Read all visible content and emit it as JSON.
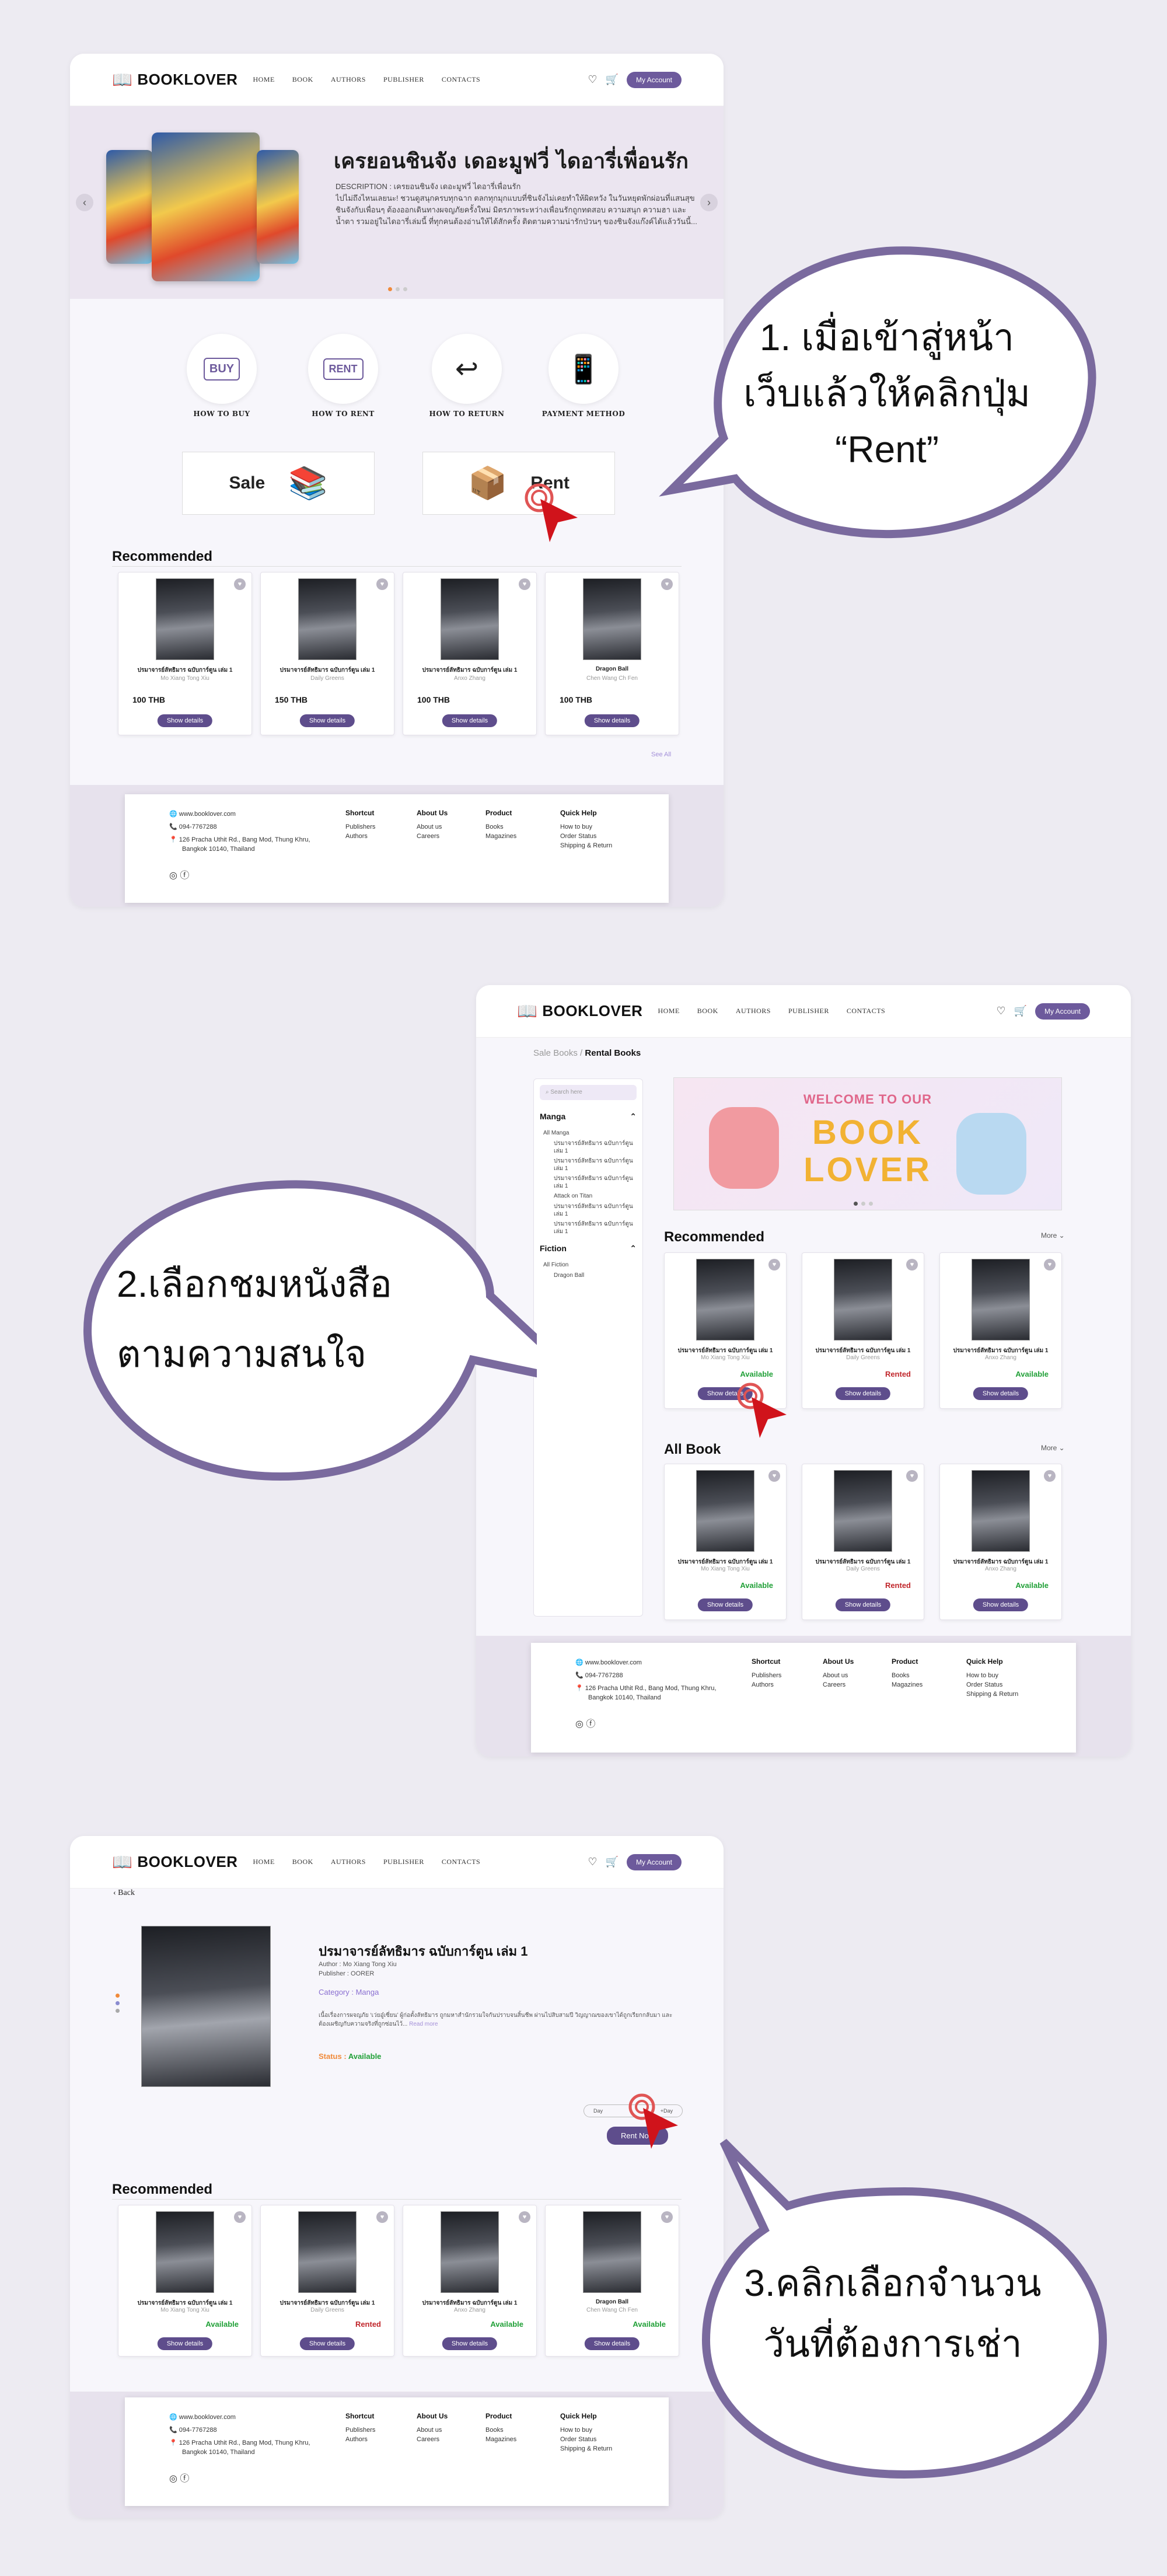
{
  "nav": {
    "logo": "BOOKLOVER",
    "links": [
      "HOME",
      "BOOK",
      "AUTHORS",
      "PUBLISHER",
      "CONTACTS"
    ],
    "account": "My Account"
  },
  "hero": {
    "title": "เครยอนชินจัง เดอะมูฟวี่ ไดอารี่เพื่อนรัก",
    "description": "DESCRIPTION : เครยอนชินจัง เดอะมูฟวี่ ไดอารี่เพื่อนรัก\nไปไม่ถึงไหนเลยนะ! ชวนดูสนุกครบทุกฉาก ตลกทุกมุกแบบที่ชินจังไม่เคยทำให้ผิดหวัง ในวันหยุดพักผ่อนที่แสนสุข ชินจังกับเพื่อนๆ ต้องออกเดินทางผจญภัยครั้งใหม่ มิตรภาพระหว่างเพื่อนรักถูกทดสอบ ความสนุก ความฮา และน้ำตา รวมอยู่ในไดอารี่เล่มนี้ ที่ทุกคนต้องอ่านให้ได้สักครั้ง ติดตามความน่ารักป่วนๆ ของชินจังแก๊งค์ได้แล้ววันนี้..."
  },
  "services": [
    "HOW TO BUY",
    "HOW TO RENT",
    "HOW TO RETURN",
    "PAYMENT METHOD"
  ],
  "service_icon_text": [
    "BUY",
    "RENT"
  ],
  "categories": {
    "sale": "Sale",
    "rent": "Rent"
  },
  "recommended_title": "Recommended",
  "all_book_title": "All Book",
  "see_all": "See All",
  "more": "More",
  "book_name": "ปรมาจารย์ลัทธิมาร ฉบับการ์ตูน เล่ม 1",
  "dragon": "Dragon Ball",
  "authors": [
    "Mo Xiang Tong Xiu",
    "Daily Greens",
    "Anxo Zhang",
    "Chen Wang Ch Fen"
  ],
  "prices": [
    "100 THB",
    "150 THB",
    "100 THB",
    "100 THB"
  ],
  "status_available": "Available",
  "status_rented": "Rented",
  "show_details": "Show details",
  "footer": {
    "web": "www.booklover.com",
    "phone": "094-7767288",
    "address1": "126 Pracha Uthit Rd., Bang Mod, Thung Khru,",
    "address2": "Bangkok 10140, Thailand",
    "shortcut": {
      "title": "Shortcut",
      "items": [
        "Publishers",
        "Authors"
      ]
    },
    "about": {
      "title": "About Us",
      "items": [
        "About us",
        "Careers"
      ]
    },
    "product": {
      "title": "Product",
      "items": [
        "Books",
        "Magazines"
      ]
    },
    "help": {
      "title": "Quick Help",
      "items": [
        "How to buy",
        "Order Status",
        "Shipping & Return"
      ]
    }
  },
  "bubbles": {
    "b1": [
      "1. เมื่อเข้าสู่หน้า",
      "เว็บแล้วให้คลิกปุ่ม",
      "“Rent”"
    ],
    "b2": [
      "2.เลือกชมหนังสือ",
      "ตามความสนใจ"
    ],
    "b3": [
      "3.คลิกเลือกจำนวน",
      "วันที่ต้องการเช่า"
    ]
  },
  "s2": {
    "crumb_a": "Sale Books",
    "crumb_sep": " / ",
    "crumb_b": "Rental Books",
    "search_placeholder": "Search here",
    "manga": "Manga",
    "all_manga": "All Manga",
    "manga_items": [
      "ปรมาจารย์ลัทธิมาร ฉบับการ์ตูน เล่ม 1",
      "ปรมาจารย์ลัทธิมาร ฉบับการ์ตูน เล่ม 1",
      "ปรมาจารย์ลัทธิมาร ฉบับการ์ตูน เล่ม 1",
      "Attack on Titan",
      "ปรมาจารย์ลัทธิมาร ฉบับการ์ตูน เล่ม 1",
      "ปรมาจารย์ลัทธิมาร ฉบับการ์ตูน เล่ม 1"
    ],
    "fiction": "Fiction",
    "all_fiction": "All Fiction",
    "fiction_items": [
      "Dragon Ball"
    ],
    "banner_l1": "WELCOME TO OUR",
    "banner_l2": "BOOK",
    "banner_l3": "LOVER"
  },
  "s3": {
    "back": "Back",
    "title": "ปรมาจารย์ลัทธิมาร ฉบับการ์ตูน เล่ม 1",
    "author": "Author : Mo Xiang Tong Xiu",
    "publisher": "Publisher : OORER",
    "category": "Category : Manga",
    "desc": "เนื้อเรื่องการผจญภัย ‘เว่ยอู๋เซี่ยน’ ผู้ก่อตั้งลัทธิมาร ถูกมหาสำนักรวมใจกันปราบจนสิ้นชีพ ผ่านไปสิบสามปี วิญญาณของเขาได้ถูกเรียกกลับมา และต้องเผชิญกับความจริงที่ถูกซ่อนไว้...",
    "readmore": "Read more",
    "status_label": "Status :",
    "status": "Available",
    "days": [
      "Day",
      "+Day"
    ],
    "rent_now": "Rent Now"
  }
}
